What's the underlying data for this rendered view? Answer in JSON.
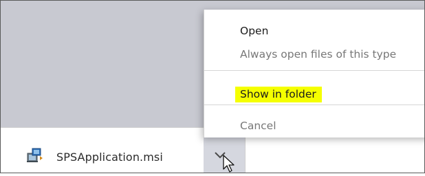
{
  "download_bar": {
    "file_name": "SPSApplication.msi",
    "file_icon": "msi-installer-icon",
    "menu_button_icon": "chevron-down-icon"
  },
  "context_menu": {
    "items": [
      {
        "label": "Open",
        "enabled": true
      },
      {
        "label": "Always open files of this type",
        "enabled": false
      },
      {
        "label": "Show in folder",
        "enabled": true,
        "highlighted": true
      },
      {
        "label": "Cancel",
        "enabled": false
      }
    ]
  },
  "colors": {
    "page_background": "#c8c9d1",
    "highlight": "#f5ff00",
    "disabled_text": "#777777",
    "menu_button_background": "#d5d7df"
  }
}
